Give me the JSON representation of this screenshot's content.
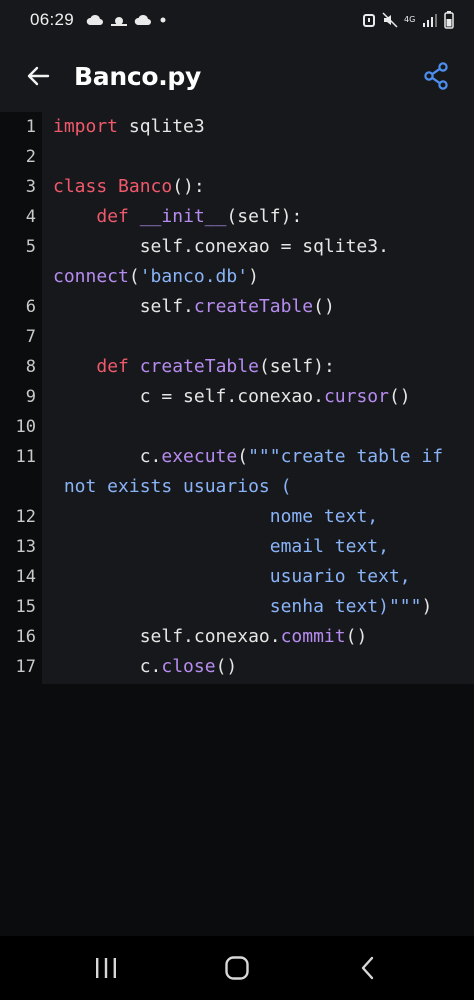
{
  "status_bar": {
    "time": "06:29",
    "network_label": "4G"
  },
  "app_bar": {
    "title": "Banco.py"
  },
  "code": {
    "lines": [
      {
        "n": "1",
        "tokens": [
          {
            "t": "import",
            "c": "kw"
          },
          {
            "t": " sqlite3",
            "c": ""
          }
        ]
      },
      {
        "n": "2",
        "tokens": []
      },
      {
        "n": "3",
        "tokens": [
          {
            "t": "class",
            "c": "kw"
          },
          {
            "t": " ",
            "c": ""
          },
          {
            "t": "Banco",
            "c": "kw"
          },
          {
            "t": "():",
            "c": ""
          }
        ]
      },
      {
        "n": "4",
        "tokens": [
          {
            "t": "    ",
            "c": ""
          },
          {
            "t": "def",
            "c": "kw"
          },
          {
            "t": " ",
            "c": ""
          },
          {
            "t": "__init__",
            "c": "fn"
          },
          {
            "t": "(self):",
            "c": ""
          }
        ]
      },
      {
        "n": "5",
        "tokens": [
          {
            "t": "        self.conexao = sqlite3.",
            "c": ""
          }
        ]
      },
      {
        "n": "",
        "tokens": [
          {
            "t": "connect",
            "c": "fn"
          },
          {
            "t": "(",
            "c": ""
          },
          {
            "t": "'banco.db'",
            "c": "str"
          },
          {
            "t": ")",
            "c": ""
          }
        ]
      },
      {
        "n": "6",
        "tokens": [
          {
            "t": "        self.",
            "c": ""
          },
          {
            "t": "createTable",
            "c": "fn"
          },
          {
            "t": "()",
            "c": ""
          }
        ]
      },
      {
        "n": "7",
        "tokens": []
      },
      {
        "n": "8",
        "tokens": [
          {
            "t": "    ",
            "c": ""
          },
          {
            "t": "def",
            "c": "kw"
          },
          {
            "t": " ",
            "c": ""
          },
          {
            "t": "createTable",
            "c": "fn"
          },
          {
            "t": "(self):",
            "c": ""
          }
        ]
      },
      {
        "n": "9",
        "tokens": [
          {
            "t": "        c = self.conexao.",
            "c": ""
          },
          {
            "t": "cursor",
            "c": "fn"
          },
          {
            "t": "()",
            "c": ""
          }
        ]
      },
      {
        "n": "10",
        "tokens": []
      },
      {
        "n": "11",
        "tokens": [
          {
            "t": "        c.",
            "c": ""
          },
          {
            "t": "execute",
            "c": "fn"
          },
          {
            "t": "(",
            "c": ""
          },
          {
            "t": "\"\"\"create table if",
            "c": "str"
          }
        ]
      },
      {
        "n": "",
        "tokens": [
          {
            "t": " not exists usuarios (",
            "c": "str"
          }
        ]
      },
      {
        "n": "12",
        "tokens": [
          {
            "t": "                    ",
            "c": ""
          },
          {
            "t": "nome text,",
            "c": "str"
          }
        ]
      },
      {
        "n": "13",
        "tokens": [
          {
            "t": "                    ",
            "c": ""
          },
          {
            "t": "email text,",
            "c": "str"
          }
        ]
      },
      {
        "n": "14",
        "tokens": [
          {
            "t": "                    ",
            "c": ""
          },
          {
            "t": "usuario text,",
            "c": "str"
          }
        ]
      },
      {
        "n": "15",
        "tokens": [
          {
            "t": "                    ",
            "c": ""
          },
          {
            "t": "senha text)\"\"\"",
            "c": "str"
          },
          {
            "t": ")",
            "c": ""
          }
        ]
      },
      {
        "n": "16",
        "tokens": [
          {
            "t": "        self.conexao.",
            "c": ""
          },
          {
            "t": "commit",
            "c": "fn"
          },
          {
            "t": "()",
            "c": ""
          }
        ]
      },
      {
        "n": "17",
        "tokens": [
          {
            "t": "        c.",
            "c": ""
          },
          {
            "t": "close",
            "c": "fn"
          },
          {
            "t": "()",
            "c": ""
          }
        ]
      }
    ]
  },
  "colors": {
    "keyword": "#f0596c",
    "function": "#b68cf0",
    "string": "#8ab4f8",
    "accent": "#4d8ff0"
  },
  "icons": {
    "back": "arrow-left-icon",
    "share": "share-icon",
    "nav_recents": "recents-icon",
    "nav_home": "home-icon",
    "nav_back": "chevron-left-icon"
  }
}
